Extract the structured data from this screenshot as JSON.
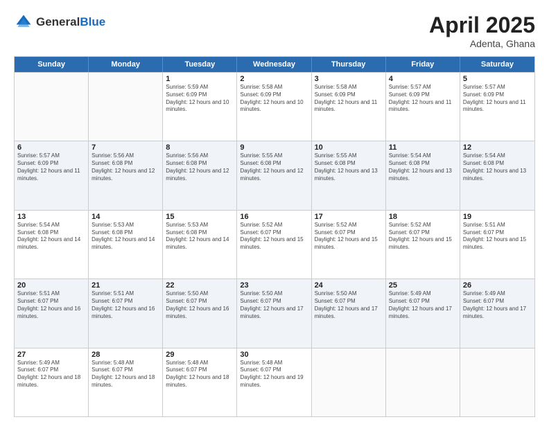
{
  "header": {
    "logo_general": "General",
    "logo_blue": "Blue",
    "title": "April 2025",
    "location": "Adenta, Ghana"
  },
  "calendar": {
    "days_of_week": [
      "Sunday",
      "Monday",
      "Tuesday",
      "Wednesday",
      "Thursday",
      "Friday",
      "Saturday"
    ],
    "weeks": [
      [
        {
          "day": "",
          "info": ""
        },
        {
          "day": "",
          "info": ""
        },
        {
          "day": "1",
          "info": "Sunrise: 5:59 AM\nSunset: 6:09 PM\nDaylight: 12 hours and 10 minutes."
        },
        {
          "day": "2",
          "info": "Sunrise: 5:58 AM\nSunset: 6:09 PM\nDaylight: 12 hours and 10 minutes."
        },
        {
          "day": "3",
          "info": "Sunrise: 5:58 AM\nSunset: 6:09 PM\nDaylight: 12 hours and 11 minutes."
        },
        {
          "day": "4",
          "info": "Sunrise: 5:57 AM\nSunset: 6:09 PM\nDaylight: 12 hours and 11 minutes."
        },
        {
          "day": "5",
          "info": "Sunrise: 5:57 AM\nSunset: 6:09 PM\nDaylight: 12 hours and 11 minutes."
        }
      ],
      [
        {
          "day": "6",
          "info": "Sunrise: 5:57 AM\nSunset: 6:09 PM\nDaylight: 12 hours and 11 minutes."
        },
        {
          "day": "7",
          "info": "Sunrise: 5:56 AM\nSunset: 6:08 PM\nDaylight: 12 hours and 12 minutes."
        },
        {
          "day": "8",
          "info": "Sunrise: 5:56 AM\nSunset: 6:08 PM\nDaylight: 12 hours and 12 minutes."
        },
        {
          "day": "9",
          "info": "Sunrise: 5:55 AM\nSunset: 6:08 PM\nDaylight: 12 hours and 12 minutes."
        },
        {
          "day": "10",
          "info": "Sunrise: 5:55 AM\nSunset: 6:08 PM\nDaylight: 12 hours and 13 minutes."
        },
        {
          "day": "11",
          "info": "Sunrise: 5:54 AM\nSunset: 6:08 PM\nDaylight: 12 hours and 13 minutes."
        },
        {
          "day": "12",
          "info": "Sunrise: 5:54 AM\nSunset: 6:08 PM\nDaylight: 12 hours and 13 minutes."
        }
      ],
      [
        {
          "day": "13",
          "info": "Sunrise: 5:54 AM\nSunset: 6:08 PM\nDaylight: 12 hours and 14 minutes."
        },
        {
          "day": "14",
          "info": "Sunrise: 5:53 AM\nSunset: 6:08 PM\nDaylight: 12 hours and 14 minutes."
        },
        {
          "day": "15",
          "info": "Sunrise: 5:53 AM\nSunset: 6:08 PM\nDaylight: 12 hours and 14 minutes."
        },
        {
          "day": "16",
          "info": "Sunrise: 5:52 AM\nSunset: 6:07 PM\nDaylight: 12 hours and 15 minutes."
        },
        {
          "day": "17",
          "info": "Sunrise: 5:52 AM\nSunset: 6:07 PM\nDaylight: 12 hours and 15 minutes."
        },
        {
          "day": "18",
          "info": "Sunrise: 5:52 AM\nSunset: 6:07 PM\nDaylight: 12 hours and 15 minutes."
        },
        {
          "day": "19",
          "info": "Sunrise: 5:51 AM\nSunset: 6:07 PM\nDaylight: 12 hours and 15 minutes."
        }
      ],
      [
        {
          "day": "20",
          "info": "Sunrise: 5:51 AM\nSunset: 6:07 PM\nDaylight: 12 hours and 16 minutes."
        },
        {
          "day": "21",
          "info": "Sunrise: 5:51 AM\nSunset: 6:07 PM\nDaylight: 12 hours and 16 minutes."
        },
        {
          "day": "22",
          "info": "Sunrise: 5:50 AM\nSunset: 6:07 PM\nDaylight: 12 hours and 16 minutes."
        },
        {
          "day": "23",
          "info": "Sunrise: 5:50 AM\nSunset: 6:07 PM\nDaylight: 12 hours and 17 minutes."
        },
        {
          "day": "24",
          "info": "Sunrise: 5:50 AM\nSunset: 6:07 PM\nDaylight: 12 hours and 17 minutes."
        },
        {
          "day": "25",
          "info": "Sunrise: 5:49 AM\nSunset: 6:07 PM\nDaylight: 12 hours and 17 minutes."
        },
        {
          "day": "26",
          "info": "Sunrise: 5:49 AM\nSunset: 6:07 PM\nDaylight: 12 hours and 17 minutes."
        }
      ],
      [
        {
          "day": "27",
          "info": "Sunrise: 5:49 AM\nSunset: 6:07 PM\nDaylight: 12 hours and 18 minutes."
        },
        {
          "day": "28",
          "info": "Sunrise: 5:48 AM\nSunset: 6:07 PM\nDaylight: 12 hours and 18 minutes."
        },
        {
          "day": "29",
          "info": "Sunrise: 5:48 AM\nSunset: 6:07 PM\nDaylight: 12 hours and 18 minutes."
        },
        {
          "day": "30",
          "info": "Sunrise: 5:48 AM\nSunset: 6:07 PM\nDaylight: 12 hours and 19 minutes."
        },
        {
          "day": "",
          "info": ""
        },
        {
          "day": "",
          "info": ""
        },
        {
          "day": "",
          "info": ""
        }
      ]
    ]
  }
}
